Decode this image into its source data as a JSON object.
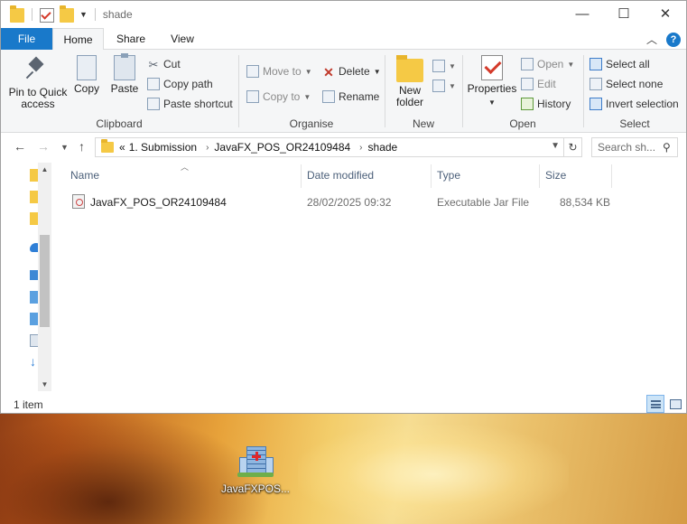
{
  "window": {
    "title": "shade",
    "controls": {
      "minimize": "—",
      "maximize": "☐",
      "close": "✕"
    }
  },
  "ribbon": {
    "tabs": [
      {
        "label": "File"
      },
      {
        "label": "Home"
      },
      {
        "label": "Share"
      },
      {
        "label": "View"
      }
    ],
    "help": "?",
    "clipboard": {
      "label": "Clipboard",
      "pin_line1": "Pin to Quick",
      "pin_line2": "access",
      "copy": "Copy",
      "paste": "Paste",
      "cut": "Cut",
      "copy_path": "Copy path",
      "paste_shortcut": "Paste shortcut"
    },
    "organise": {
      "label": "Organise",
      "move_to": "Move to",
      "copy_to": "Copy to",
      "delete": "Delete",
      "rename": "Rename"
    },
    "new": {
      "label": "New",
      "new_folder_line1": "New",
      "new_folder_line2": "folder"
    },
    "open": {
      "label": "Open",
      "properties": "Properties",
      "open": "Open",
      "edit": "Edit",
      "history": "History"
    },
    "select": {
      "label": "Select",
      "select_all": "Select all",
      "select_none": "Select none",
      "invert_selection": "Invert selection"
    }
  },
  "address": {
    "overflow": "«",
    "crumbs": [
      "1. Submission",
      "JavaFX_POS_OR24109484",
      "shade"
    ],
    "search_placeholder": "Search sh..."
  },
  "columns": {
    "name": "Name",
    "date_modified": "Date modified",
    "type": "Type",
    "size": "Size"
  },
  "files": [
    {
      "name": "JavaFX_POS_OR24109484",
      "date_modified": "28/02/2025 09:32",
      "type": "Executable Jar File",
      "size": "88,534 KB"
    }
  ],
  "status": {
    "item_count": "1 item"
  },
  "desktop": {
    "icon_label": "JavaFXPOS..."
  }
}
